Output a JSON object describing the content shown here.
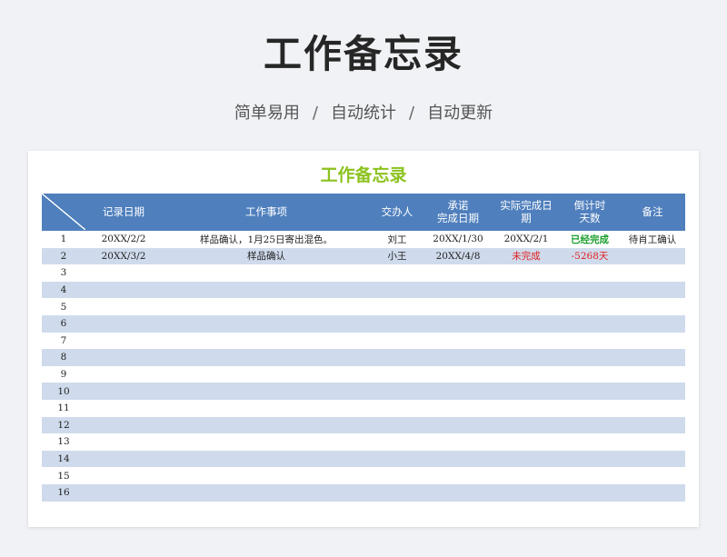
{
  "hero": {
    "title": "工作备忘录",
    "subtitle_parts": [
      "简单易用",
      "/",
      "自动统计",
      "/",
      "自动更新"
    ]
  },
  "sheet": {
    "title": "工作备忘录",
    "headers": [
      "",
      "记录日期",
      "工作事项",
      "交办人",
      "承诺\n完成日期",
      "实际完成日\n期",
      "倒计时\n天数",
      "备注"
    ],
    "rows": [
      {
        "no": "1",
        "record_date": "20XX/2/2",
        "task": "样品确认，1月25日寄出混色。",
        "assignee": "刘工",
        "promised_date": "20XX/1/30",
        "actual_date": "20XX/2/1",
        "countdown": "已经完成",
        "note": "待肖工确认"
      },
      {
        "no": "2",
        "record_date": "20XX/3/2",
        "task": "样品确认",
        "assignee": "小王",
        "promised_date": "20XX/4/8",
        "actual_date": "未完成",
        "countdown": "-5268天",
        "note": ""
      },
      {
        "no": "3",
        "record_date": "",
        "task": "",
        "assignee": "",
        "promised_date": "",
        "actual_date": "",
        "countdown": "",
        "note": ""
      },
      {
        "no": "4",
        "record_date": "",
        "task": "",
        "assignee": "",
        "promised_date": "",
        "actual_date": "",
        "countdown": "",
        "note": ""
      },
      {
        "no": "5",
        "record_date": "",
        "task": "",
        "assignee": "",
        "promised_date": "",
        "actual_date": "",
        "countdown": "",
        "note": ""
      },
      {
        "no": "6",
        "record_date": "",
        "task": "",
        "assignee": "",
        "promised_date": "",
        "actual_date": "",
        "countdown": "",
        "note": ""
      },
      {
        "no": "7",
        "record_date": "",
        "task": "",
        "assignee": "",
        "promised_date": "",
        "actual_date": "",
        "countdown": "",
        "note": ""
      },
      {
        "no": "8",
        "record_date": "",
        "task": "",
        "assignee": "",
        "promised_date": "",
        "actual_date": "",
        "countdown": "",
        "note": ""
      },
      {
        "no": "9",
        "record_date": "",
        "task": "",
        "assignee": "",
        "promised_date": "",
        "actual_date": "",
        "countdown": "",
        "note": ""
      },
      {
        "no": "10",
        "record_date": "",
        "task": "",
        "assignee": "",
        "promised_date": "",
        "actual_date": "",
        "countdown": "",
        "note": ""
      },
      {
        "no": "11",
        "record_date": "",
        "task": "",
        "assignee": "",
        "promised_date": "",
        "actual_date": "",
        "countdown": "",
        "note": ""
      },
      {
        "no": "12",
        "record_date": "",
        "task": "",
        "assignee": "",
        "promised_date": "",
        "actual_date": "",
        "countdown": "",
        "note": ""
      },
      {
        "no": "13",
        "record_date": "",
        "task": "",
        "assignee": "",
        "promised_date": "",
        "actual_date": "",
        "countdown": "",
        "note": ""
      },
      {
        "no": "14",
        "record_date": "",
        "task": "",
        "assignee": "",
        "promised_date": "",
        "actual_date": "",
        "countdown": "",
        "note": ""
      },
      {
        "no": "15",
        "record_date": "",
        "task": "",
        "assignee": "",
        "promised_date": "",
        "actual_date": "",
        "countdown": "",
        "note": ""
      },
      {
        "no": "16",
        "record_date": "",
        "task": "",
        "assignee": "",
        "promised_date": "",
        "actual_date": "",
        "countdown": "",
        "note": ""
      }
    ]
  },
  "colors": {
    "header_blue": "#4f7fbd",
    "stripe_blue": "#cfdbec",
    "title_green": "#8cc21f",
    "done_green": "#1a9e2c",
    "overdue_red": "#e02020"
  }
}
